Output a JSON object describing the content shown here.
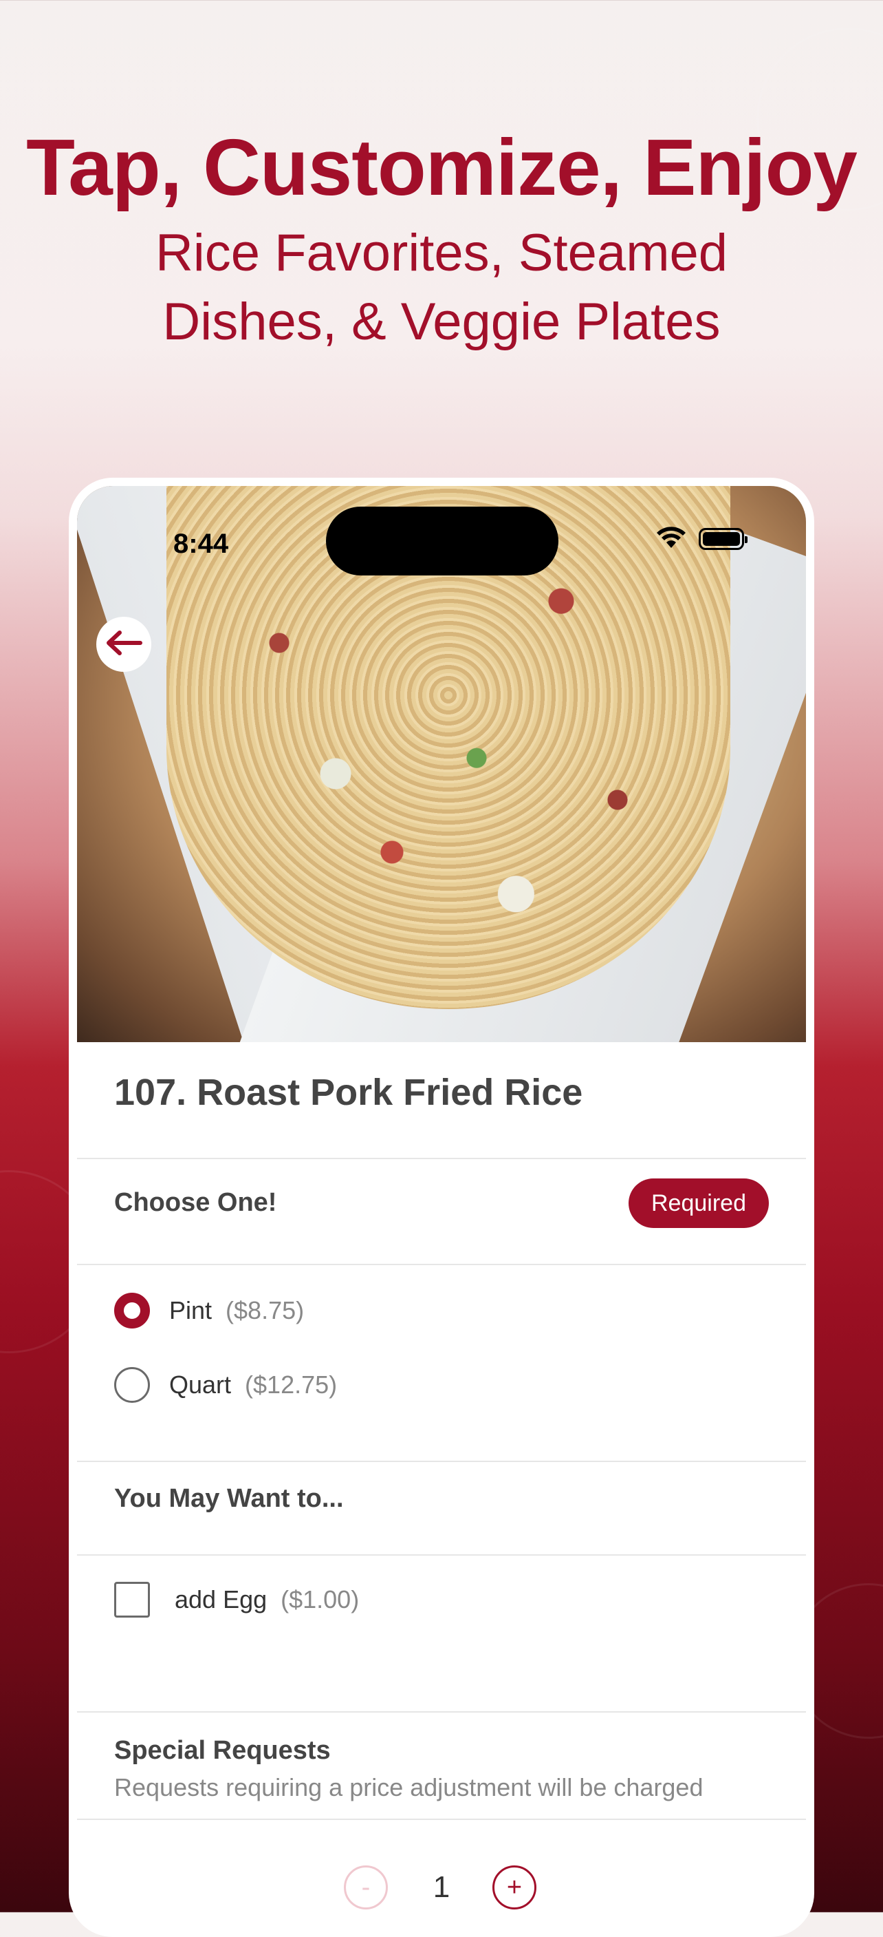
{
  "promo": {
    "headline": "Tap, Customize, Enjoy",
    "subline_1": "Rice Favorites, Steamed",
    "subline_2": "Dishes, & Veggie Plates"
  },
  "status_bar": {
    "time": "8:44",
    "icons": [
      "wifi-icon",
      "battery-icon"
    ]
  },
  "hero": {
    "image": "roast-pork-fried-rice-photo",
    "back_icon": "arrow-left-icon"
  },
  "item": {
    "title": "107. Roast Pork Fried Rice"
  },
  "size_group": {
    "label": "Choose One!",
    "badge": "Required",
    "options": [
      {
        "name": "Pint",
        "price": "($8.75)",
        "selected": true
      },
      {
        "name": "Quart",
        "price": "($12.75)",
        "selected": false
      }
    ]
  },
  "addons_group": {
    "label": "You May Want to...",
    "options": [
      {
        "name": "add Egg",
        "price": "($1.00)",
        "checked": false
      }
    ]
  },
  "special_requests": {
    "label": "Special Requests",
    "subtext": "Requests requiring a price adjustment will be charged"
  },
  "quantity": {
    "minus_label": "-",
    "value": "1",
    "plus_label": "+"
  },
  "colors": {
    "brand": "#a20f2a",
    "text_dark": "#444444",
    "text_muted": "#888888"
  }
}
